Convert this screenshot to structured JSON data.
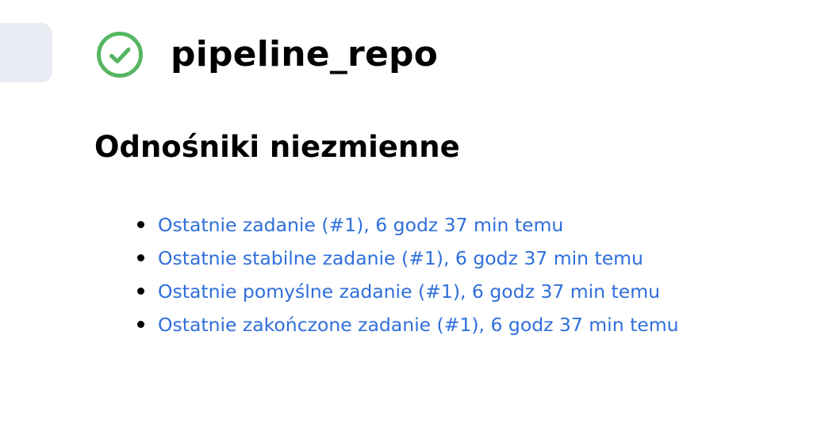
{
  "job": {
    "title": "pipeline_repo",
    "status_icon": "check-circle-icon",
    "status_color": "#56b662"
  },
  "permalinks": {
    "heading": "Odnośniki niezmienne",
    "link_color": "#2f6fdb",
    "items": [
      {
        "label": "Ostatnie zadanie (#1), 6 godz 37 min temu"
      },
      {
        "label": "Ostatnie stabilne zadanie (#1), 6 godz 37 min temu"
      },
      {
        "label": "Ostatnie pomyślne zadanie (#1), 6 godz 37 min temu"
      },
      {
        "label": "Ostatnie zakończone zadanie (#1), 6 godz 37 min temu"
      }
    ]
  }
}
